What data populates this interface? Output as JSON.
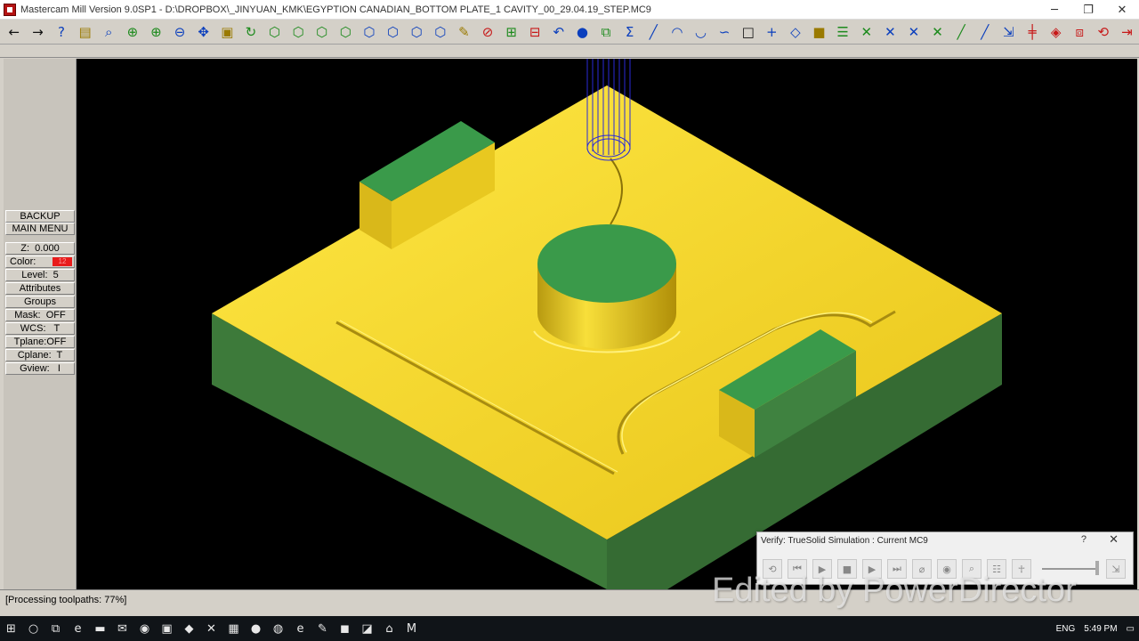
{
  "window": {
    "title": "Mastercam Mill Version 9.0SP1 - D:\\DROPBOX\\_JINYUAN_KMK\\EGYPTION CANADIAN_BOTTOM PLATE_1 CAVITY_00_29.04.19_STEP.MC9",
    "minimize": "─",
    "restore": "❐",
    "close": "✕"
  },
  "toolbar": [
    {
      "name": "back-arrow-icon",
      "glyph": "←",
      "tone": "black"
    },
    {
      "name": "forward-arrow-icon",
      "glyph": "→",
      "tone": "black"
    },
    {
      "name": "help-icon",
      "glyph": "?",
      "tone": ""
    },
    {
      "name": "notepad-icon",
      "glyph": "▤",
      "tone": "yellow"
    },
    {
      "name": "analyze-icon",
      "glyph": "⌕",
      "tone": ""
    },
    {
      "name": "zoom-window-icon",
      "glyph": "⊕",
      "tone": "green"
    },
    {
      "name": "zoom-in-icon",
      "glyph": "⊕",
      "tone": "green"
    },
    {
      "name": "zoom-out-icon",
      "glyph": "⊖",
      "tone": ""
    },
    {
      "name": "pan-icon",
      "glyph": "✥",
      "tone": ""
    },
    {
      "name": "fit-screen-icon",
      "glyph": "▣",
      "tone": "yellow"
    },
    {
      "name": "repaint-icon",
      "glyph": "↻",
      "tone": "green"
    },
    {
      "name": "view-top-icon",
      "glyph": "⬡",
      "tone": "green"
    },
    {
      "name": "view-front-icon",
      "glyph": "⬡",
      "tone": "green"
    },
    {
      "name": "view-side-icon",
      "glyph": "⬡",
      "tone": "green"
    },
    {
      "name": "view-iso-icon",
      "glyph": "⬡",
      "tone": "green"
    },
    {
      "name": "cube-1-icon",
      "glyph": "⬡",
      "tone": ""
    },
    {
      "name": "cube-2-icon",
      "glyph": "⬡",
      "tone": ""
    },
    {
      "name": "cube-3-icon",
      "glyph": "⬡",
      "tone": ""
    },
    {
      "name": "cube-4-icon",
      "glyph": "⬡",
      "tone": ""
    },
    {
      "name": "eraser-icon",
      "glyph": "✎",
      "tone": "yellow"
    },
    {
      "name": "no-entry-icon",
      "glyph": "⊘",
      "tone": "red"
    },
    {
      "name": "transform-icon",
      "glyph": "⊞",
      "tone": "green"
    },
    {
      "name": "mirror-icon",
      "glyph": "⊟",
      "tone": "red"
    },
    {
      "name": "undo-icon",
      "glyph": "↶",
      "tone": ""
    },
    {
      "name": "sphere-icon",
      "glyph": "●",
      "tone": ""
    },
    {
      "name": "group-icon",
      "glyph": "⧉",
      "tone": "green"
    },
    {
      "name": "sum-icon",
      "glyph": "Σ",
      "tone": ""
    },
    {
      "name": "line-icon",
      "glyph": "╱",
      "tone": ""
    },
    {
      "name": "arc-icon",
      "glyph": "◠",
      "tone": ""
    },
    {
      "name": "fillet-icon",
      "glyph": "◡",
      "tone": ""
    },
    {
      "name": "spline-icon",
      "glyph": "∽",
      "tone": ""
    },
    {
      "name": "rectangle-icon",
      "glyph": "□",
      "tone": "black"
    },
    {
      "name": "point-icon",
      "glyph": "+",
      "tone": ""
    },
    {
      "name": "plane-icon",
      "glyph": "◇",
      "tone": ""
    },
    {
      "name": "solid-icon",
      "glyph": "■",
      "tone": "yellow"
    },
    {
      "name": "levels-icon",
      "glyph": "☰",
      "tone": "green"
    },
    {
      "name": "trim-1-icon",
      "glyph": "✕",
      "tone": "green"
    },
    {
      "name": "trim-2-icon",
      "glyph": "✕",
      "tone": ""
    },
    {
      "name": "trim-3-icon",
      "glyph": "✕",
      "tone": ""
    },
    {
      "name": "trim-4-icon",
      "glyph": "✕",
      "tone": "green"
    },
    {
      "name": "extend-icon",
      "glyph": "╱",
      "tone": "green"
    },
    {
      "name": "break-icon",
      "glyph": "╱",
      "tone": ""
    },
    {
      "name": "join-icon",
      "glyph": "⇲",
      "tone": ""
    },
    {
      "name": "split-icon",
      "glyph": "╪",
      "tone": "red"
    },
    {
      "name": "offset-icon",
      "glyph": "◈",
      "tone": "red"
    },
    {
      "name": "copy-icon",
      "glyph": "⧈",
      "tone": "red"
    },
    {
      "name": "rotate-icon",
      "glyph": "⟲",
      "tone": "red"
    },
    {
      "name": "end-icon",
      "glyph": "⇥",
      "tone": "red"
    }
  ],
  "menu": {
    "backup": "BACKUP",
    "main_menu": "MAIN MENU",
    "z": "Z:  0.000",
    "color_label": "Color:",
    "color_value": "12",
    "level": "Level:  5",
    "attributes": "Attributes",
    "groups": "Groups",
    "mask": "Mask:  OFF",
    "wcs": "WCS:   T",
    "tplane": "Tplane:OFF",
    "cplane": "Cplane:  T",
    "gview": "Gview:   I"
  },
  "status": {
    "text": "[Processing toolpaths:   77%]",
    "progress_percent": 77
  },
  "verify": {
    "title": "Verify: TrueSolid Simulation : Current MC9",
    "help": "?",
    "close": "✕",
    "buttons": [
      {
        "name": "verify-reset-icon",
        "glyph": "⟲"
      },
      {
        "name": "verify-rewind-icon",
        "glyph": "⏮"
      },
      {
        "name": "verify-play-icon",
        "glyph": "▶"
      },
      {
        "name": "verify-stop-icon",
        "glyph": "■"
      },
      {
        "name": "verify-step-icon",
        "glyph": "▶"
      },
      {
        "name": "verify-fast-forward-icon",
        "glyph": "⏭"
      },
      {
        "name": "verify-tool-icon",
        "glyph": "⌀"
      },
      {
        "name": "verify-light-icon",
        "glyph": "◉"
      },
      {
        "name": "verify-zoom-icon",
        "glyph": "⌕"
      },
      {
        "name": "verify-options-icon",
        "glyph": "☷"
      },
      {
        "name": "verify-figure-icon",
        "glyph": "☥"
      },
      {
        "name": "verify-exit-icon",
        "glyph": "⇲"
      }
    ]
  },
  "watermark": "Edited by PowerDirector",
  "taskbar": {
    "icons": [
      {
        "name": "windows-start-icon",
        "glyph": "⊞"
      },
      {
        "name": "search-icon",
        "glyph": "○"
      },
      {
        "name": "task-view-icon",
        "glyph": "⧉"
      },
      {
        "name": "edge-icon",
        "glyph": "e"
      },
      {
        "name": "file-explorer-icon",
        "glyph": "▬"
      },
      {
        "name": "mail-icon",
        "glyph": "✉"
      },
      {
        "name": "chrome-icon",
        "glyph": "◉"
      },
      {
        "name": "app-green-icon",
        "glyph": "▣"
      },
      {
        "name": "app-blue-icon",
        "glyph": "◆"
      },
      {
        "name": "app-x-icon",
        "glyph": "✕"
      },
      {
        "name": "calculator-icon",
        "glyph": "▦"
      },
      {
        "name": "app-circle-icon",
        "glyph": "●"
      },
      {
        "name": "app-blue2-icon",
        "glyph": "◍"
      },
      {
        "name": "ie-icon",
        "glyph": "e"
      },
      {
        "name": "app-feather-icon",
        "glyph": "✎"
      },
      {
        "name": "app-red-icon",
        "glyph": "◼"
      },
      {
        "name": "app-yellow-icon",
        "glyph": "◪"
      },
      {
        "name": "app-cyan-icon",
        "glyph": "⌂"
      },
      {
        "name": "mastercam-taskbar-icon",
        "glyph": "M"
      }
    ],
    "tray": {
      "language": "ENG",
      "time": "5:49 PM"
    }
  }
}
